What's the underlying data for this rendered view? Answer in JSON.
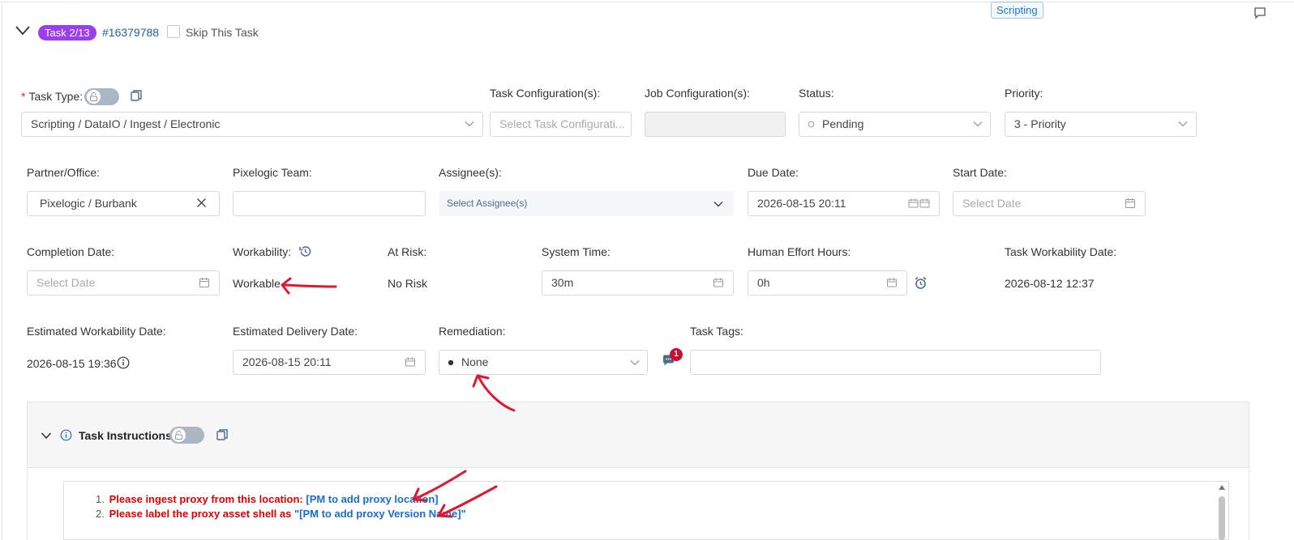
{
  "header": {
    "tag": "Scripting",
    "task_badge": "Task 2/13",
    "task_id": "#16379788",
    "skip_label": "Skip This Task"
  },
  "row1": {
    "task_type": {
      "label": "Task Type:",
      "value": "Scripting / DataIO / Ingest / Electronic"
    },
    "task_config": {
      "label": "Task Configuration(s):",
      "placeholder": "Select Task Configurati..."
    },
    "job_config": {
      "label": "Job Configuration(s):",
      "value": ""
    },
    "status": {
      "label": "Status:",
      "value": "Pending"
    },
    "priority": {
      "label": "Priority:",
      "value": "3 - Priority"
    }
  },
  "row2": {
    "partner": {
      "label": "Partner/Office:",
      "value": "Pixelogic / Burbank"
    },
    "team": {
      "label": "Pixelogic Team:",
      "value": ""
    },
    "assignee": {
      "label": "Assignee(s):",
      "placeholder": "Select Assignee(s)"
    },
    "due_date": {
      "label": "Due Date:",
      "value": "2026-08-15 20:11"
    },
    "start_date": {
      "label": "Start Date:",
      "placeholder": "Select Date"
    }
  },
  "row3": {
    "completion_date": {
      "label": "Completion Date:",
      "placeholder": "Select Date"
    },
    "workability": {
      "label": "Workability:",
      "value": "Workable"
    },
    "at_risk": {
      "label": "At Risk:",
      "value": "No Risk"
    },
    "system_time": {
      "label": "System Time:",
      "value": "30m"
    },
    "human_effort": {
      "label": "Human Effort Hours:",
      "value": "0h"
    },
    "task_workability_date": {
      "label": "Task Workability Date:",
      "value": "2026-08-12 12:37"
    }
  },
  "row4": {
    "est_workability": {
      "label": "Estimated Workability Date:",
      "value": "2026-08-15 19:36"
    },
    "est_delivery": {
      "label": "Estimated Delivery Date:",
      "value": "2026-08-15 20:11"
    },
    "remediation": {
      "label": "Remediation:",
      "value": "None",
      "comment_count": "1"
    },
    "task_tags": {
      "label": "Task Tags:",
      "value": ""
    }
  },
  "instructions": {
    "title": "Task Instructions",
    "items": [
      {
        "num": "1.",
        "text": "Please ingest proxy from this location: ",
        "link": "[PM to add proxy location]",
        "suffix": ""
      },
      {
        "num": "2.",
        "text": "Please label the proxy asset shell as ",
        "link": "\"[PM to add proxy Version Name]\"",
        "suffix": ""
      }
    ]
  },
  "colors": {
    "badge": "#9b3df0",
    "link": "#1f5fa8",
    "annotation": "#e0182d",
    "required": "#e02020"
  }
}
